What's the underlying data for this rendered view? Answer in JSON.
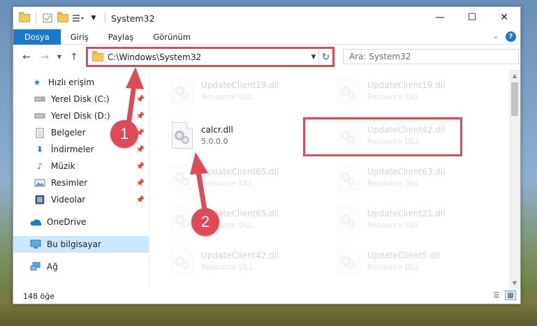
{
  "window": {
    "title": "System32",
    "minimize_glyph": "—",
    "maximize_glyph": "☐",
    "close_glyph": "✕"
  },
  "ribbon": {
    "tabs": [
      {
        "label": "Dosya"
      },
      {
        "label": "Giriş"
      },
      {
        "label": "Paylaş"
      },
      {
        "label": "Görünüm"
      }
    ]
  },
  "navigation": {
    "address": "C:\\Windows\\System32",
    "search_placeholder": "Ara: System32"
  },
  "sidebar": {
    "items": [
      {
        "label": "Hızlı erişim",
        "icon": "star-icon"
      },
      {
        "label": "Yerel Disk (C:)",
        "icon": "drive-icon"
      },
      {
        "label": "Yerel Disk (D:)",
        "icon": "drive-icon"
      },
      {
        "label": "Belgeler",
        "icon": "documents-icon"
      },
      {
        "label": "İndirmeler",
        "icon": "download-icon"
      },
      {
        "label": "Müzik",
        "icon": "music-icon"
      },
      {
        "label": "Resimler",
        "icon": "pictures-icon"
      },
      {
        "label": "Videolar",
        "icon": "videos-icon"
      },
      {
        "label": "OneDrive",
        "icon": "cloud-icon"
      },
      {
        "label": "Bu bilgisayar",
        "icon": "computer-icon"
      },
      {
        "label": "Ağ",
        "icon": "network-icon"
      }
    ]
  },
  "files": [
    {
      "name": "UpdateClient19.dll",
      "type": "Resource DLL"
    },
    {
      "name": "UpdateClient19.dll",
      "type": "Resource DLL"
    },
    {
      "name": "calcr.dll",
      "type": "5.0.0.0"
    },
    {
      "name": "UpdateClient42.dll",
      "type": "Resource DLL"
    },
    {
      "name": "UpdateClient65.dll",
      "type": "Resource DLL"
    },
    {
      "name": "UpdateClient63.dll",
      "type": "Resource DLL"
    },
    {
      "name": "UpdateClient65.dll",
      "type": "Resource DLL"
    },
    {
      "name": "UpdateClient21.dll",
      "type": "Resource DLL"
    },
    {
      "name": "UpdateClient42.dll",
      "type": "Resource DLL"
    },
    {
      "name": "UpdateClient5.dll",
      "type": "Resource DLL"
    }
  ],
  "status": {
    "item_count": "148 öğe"
  },
  "annotations": {
    "badge1": "1",
    "badge2": "2",
    "color": "#e04a58"
  },
  "colors": {
    "accent": "#1979ca",
    "selection": "#cce8ff"
  }
}
